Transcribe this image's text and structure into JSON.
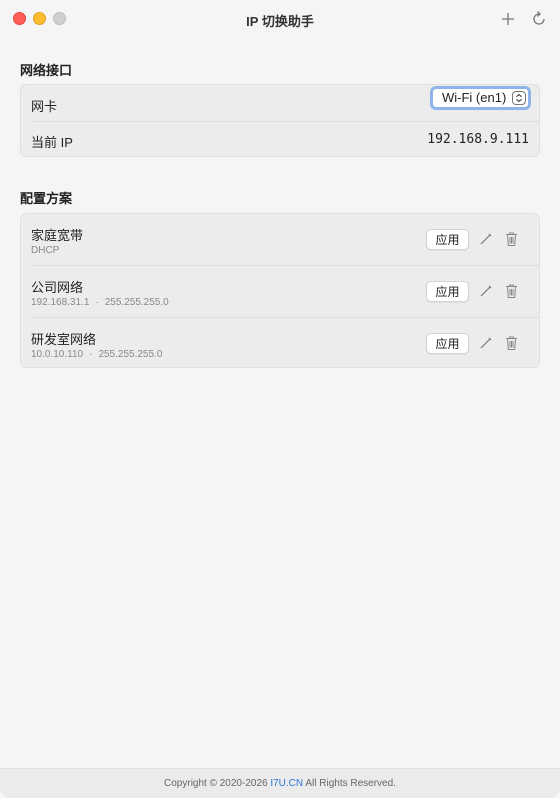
{
  "window": {
    "title": "IP 切换助手"
  },
  "toolbar": {
    "add_icon": "plus-icon",
    "refresh_icon": "refresh-icon"
  },
  "network": {
    "section_title": "网络接口",
    "adapter_label": "网卡",
    "adapter_selected": "Wi-Fi (en1)",
    "current_ip_label": "当前 IP",
    "current_ip_value": "192.168.9.111"
  },
  "plans": {
    "section_title": "配置方案",
    "apply_label": "应用",
    "items": [
      {
        "name": "家庭宽带",
        "ip": "DHCP",
        "mask": ""
      },
      {
        "name": "公司网络",
        "ip": "192.168.31.1",
        "mask": "255.255.255.0"
      },
      {
        "name": "研发室网络",
        "ip": "10.0.10.110",
        "mask": "255.255.255.0"
      }
    ],
    "separator": "·"
  },
  "footer": {
    "prefix": "Copyright © 2020-2026 ",
    "link": "I7U.CN",
    "suffix": " All Rights Reserved."
  },
  "colors": {
    "accent": "#2b76d4",
    "focus_ring": "#8eb4ea",
    "close": "#ff5f57",
    "minimize": "#febc2e"
  }
}
